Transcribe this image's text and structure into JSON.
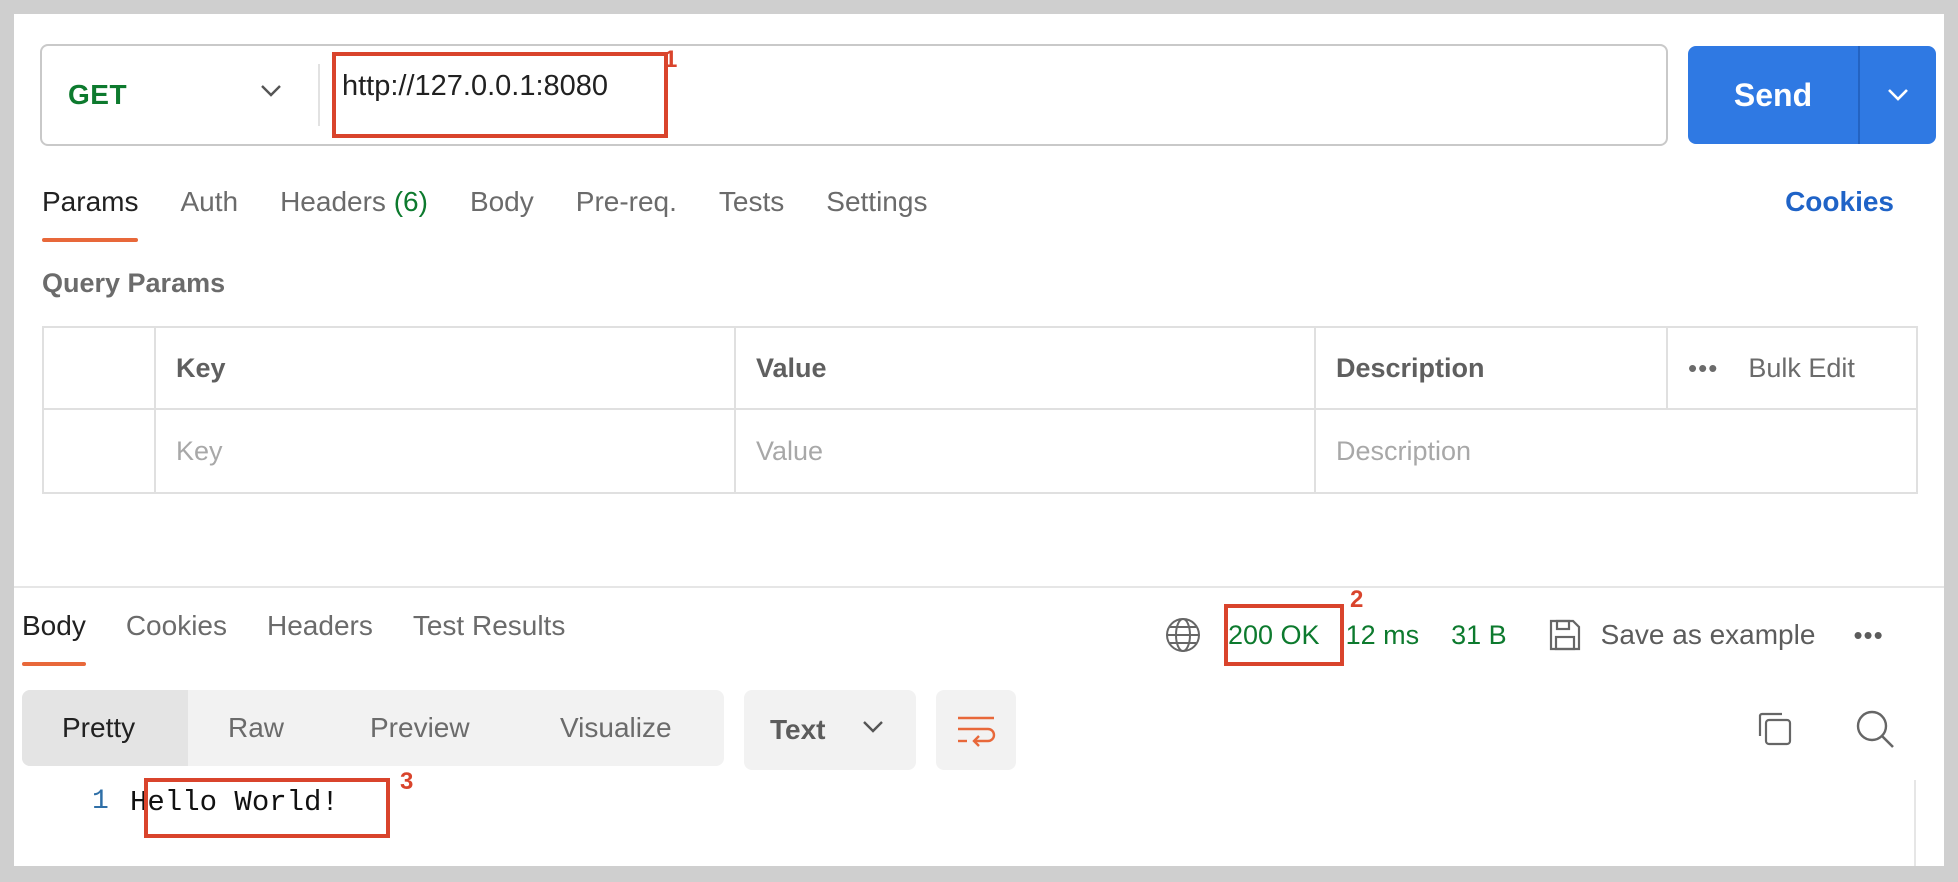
{
  "request": {
    "method": "GET",
    "url": "http://127.0.0.1:8080",
    "send_label": "Send"
  },
  "request_tabs": [
    {
      "label": "Params",
      "active": true
    },
    {
      "label": "Auth"
    },
    {
      "label": "Headers",
      "count": "(6)"
    },
    {
      "label": "Body"
    },
    {
      "label": "Pre-req."
    },
    {
      "label": "Tests"
    },
    {
      "label": "Settings"
    }
  ],
  "cookies_link": "Cookies",
  "query_params": {
    "title": "Query Params",
    "columns": [
      "Key",
      "Value",
      "Description"
    ],
    "more_icon": "•••",
    "bulk_edit": "Bulk Edit",
    "placeholders": {
      "key": "Key",
      "value": "Value",
      "description": "Description"
    }
  },
  "response": {
    "tabs": [
      "Body",
      "Cookies",
      "Headers",
      "Test Results"
    ],
    "status": "200 OK",
    "time": "12 ms",
    "size": "31 B",
    "save_label": "Save as example",
    "more_icon": "•••",
    "view_tabs": [
      "Pretty",
      "Raw",
      "Preview",
      "Visualize"
    ],
    "format": "Text",
    "line_number": "1",
    "body_text": "Hello World!"
  },
  "annotations": [
    "1",
    "2",
    "3"
  ],
  "colors": {
    "accent": "#e8683a",
    "send": "#2f79e3",
    "status_green": "#0d7a2e",
    "annotation": "#d9442c"
  }
}
